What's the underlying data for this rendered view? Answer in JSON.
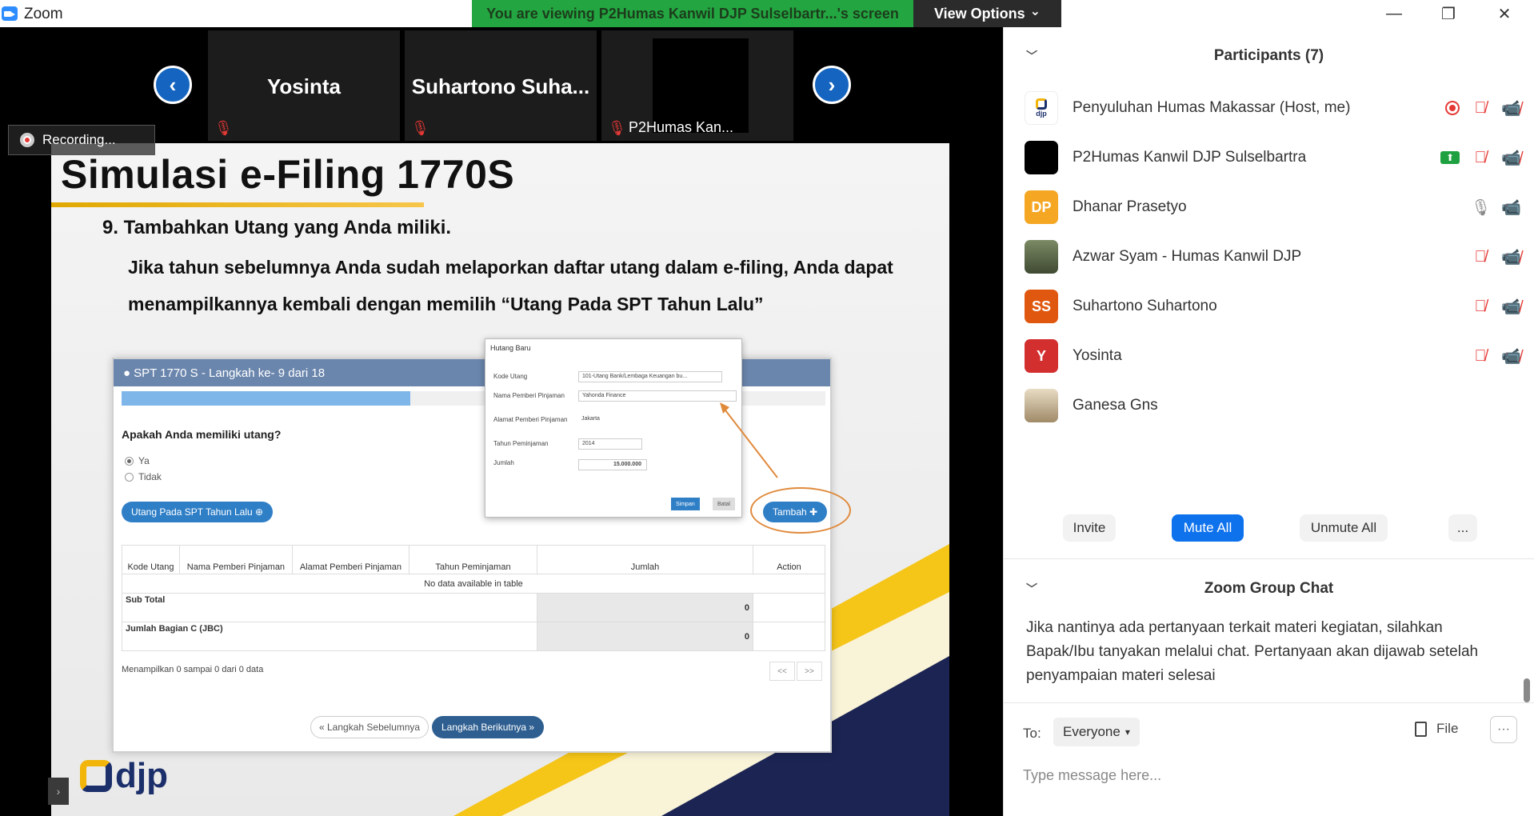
{
  "window": {
    "title": "Zoom",
    "minimize": "—",
    "restore": "❐",
    "close": "✕"
  },
  "banner": {
    "text": "You are viewing P2Humas Kanwil DJP Sulselbartr...'s screen",
    "view_options": "View Options",
    "chevron": "⌄"
  },
  "strip": {
    "prev": "‹",
    "next": "›",
    "tiles": [
      {
        "name": "Yosinta"
      },
      {
        "name": "Suhartono  Suha..."
      },
      {
        "label": "P2Humas Kan..."
      }
    ]
  },
  "recording": {
    "label": "Recording..."
  },
  "slide": {
    "title": "Simulasi e-Filing 1770S",
    "step": "9.  Tambahkan Utang yang Anda miliki.",
    "desc": "Jika tahun sebelumnya Anda sudah melaporkan daftar utang dalam e-filing, Anda dapat menampilkannya kembali dengan memilih “Utang Pada SPT Tahun Lalu”",
    "spt": {
      "header": "SPT 1770 S - Langkah ke- 9 dari 18",
      "progress": 0.41,
      "question": "Apakah Anda memiliki utang?",
      "opt_yes": "Ya",
      "opt_no": "Tidak",
      "btn_prev_year": "Utang Pada SPT Tahun Lalu ⊕",
      "btn_add": "Tambah ✚",
      "columns": [
        "Kode Utang",
        "Nama Pemberi Pinjaman",
        "Alamat Pemberi Pinjaman",
        "Tahun Peminjaman",
        "Jumlah",
        "Action"
      ],
      "no_data": "No data available in table",
      "subtotal_label": "Sub Total",
      "subtotal_value": "0",
      "jbc_label": "Jumlah Bagian C (JBC)",
      "jbc_value": "0",
      "showing": "Menampilkan 0 sampai 0 dari 0 data",
      "pager_prev": "<<",
      "pager_next": ">>",
      "step_prev": "« Langkah Sebelumnya",
      "step_next": "Langkah Berikutnya »"
    },
    "modal": {
      "title": "Hutang Baru",
      "kode_label": "Kode Utang",
      "kode_value": "101-Utang Bank/Lembaga Keuangan bu...",
      "nama_label": "Nama Pemberi Pinjaman",
      "nama_value": "Yahonda Finance",
      "alamat_label": "Alamat Pemberi Pinjaman",
      "alamat_value": "Jakarta",
      "tahun_label": "Tahun Peminjaman",
      "tahun_value": "2014",
      "jumlah_label": "Jumlah",
      "jumlah_value": "15.000.000",
      "save": "Simpan",
      "cancel": "Batal"
    },
    "logo_text": "djp"
  },
  "participants": {
    "title": "Participants (7)",
    "list": [
      {
        "name": "Penyuluhan Humas Makassar (Host, me)",
        "initials": "",
        "color": "#ffffff"
      },
      {
        "name": "P2Humas Kanwil DJP Sulselbartra",
        "initials": "",
        "color": "#000000"
      },
      {
        "name": "Dhanar Prasetyo",
        "initials": "DP",
        "color": "#f5a623"
      },
      {
        "name": "Azwar Syam - Humas Kanwil DJP",
        "initials": "",
        "color": "#5c6b4a"
      },
      {
        "name": "Suhartono Suhartono",
        "initials": "SS",
        "color": "#e0580f"
      },
      {
        "name": "Yosinta",
        "initials": "Y",
        "color": "#d32f2f"
      },
      {
        "name": "Ganesa Gns",
        "initials": "",
        "color": "#c9b79a"
      }
    ],
    "invite": "Invite",
    "mute_all": "Mute All",
    "unmute_all": "Unmute All",
    "more": "..."
  },
  "chat": {
    "title": "Zoom Group Chat",
    "message": "Jika nantinya ada pertanyaan terkait materi kegiatan, silahkan Bapak/Ibu tanyakan melalui chat. Pertanyaan akan dijawab setelah penyampaian materi selesai",
    "to_label": "To:",
    "to_value": "Everyone",
    "file": "File",
    "more": "···",
    "placeholder": "Type message here..."
  }
}
